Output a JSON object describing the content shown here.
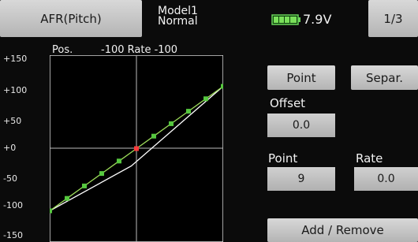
{
  "header": {
    "title": "AFR(Pitch)",
    "model_name": "Model1",
    "condition": "Normal",
    "voltage": "7.9V",
    "page": "1/3",
    "icons": {
      "battery": "battery-icon"
    }
  },
  "graph": {
    "pos_label": "Pos.",
    "rate_header": "-100 Rate  -100",
    "y_tick_labels": [
      "+150",
      "+100",
      "+50",
      "+0",
      "-50",
      "-100",
      "-150"
    ],
    "colors": {
      "curve": "#9ddc5a",
      "point": "#56c83f",
      "selected_point": "#ff3a3a",
      "base_curve": "#ffffff"
    }
  },
  "controls": {
    "point_button": "Point",
    "separ_button": "Separ.",
    "offset_label": "Offset",
    "offset_value": "0.0",
    "point_label": "Point",
    "rate_label": "Rate",
    "point_value": "9",
    "rate_value": "0.0",
    "add_remove_button": "Add / Remove"
  },
  "chart_data": {
    "type": "line",
    "xlim": [
      -100,
      100
    ],
    "ylim": [
      -150,
      150
    ],
    "grid": true,
    "series": [
      {
        "x": [
          -100,
          -80,
          -60,
          -40,
          -20,
          0,
          20,
          40,
          60,
          80,
          100
        ],
        "values": [
          -100,
          -80,
          -60,
          -40,
          -20,
          0,
          20,
          40,
          60,
          80,
          100
        ]
      },
      {
        "x": [
          -100,
          -6,
          100
        ],
        "values": [
          -100,
          -28,
          100
        ]
      }
    ],
    "selected_point_index": 5
  }
}
